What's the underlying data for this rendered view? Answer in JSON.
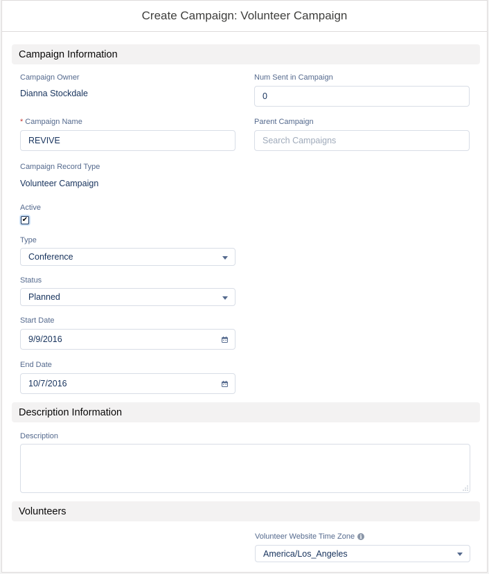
{
  "modal": {
    "title": "Create Campaign: Volunteer Campaign"
  },
  "sections": {
    "campaign_info": "Campaign Information",
    "description_info": "Description Information",
    "volunteers": "Volunteers"
  },
  "fields": {
    "campaign_owner": {
      "label": "Campaign Owner",
      "value": "Dianna Stockdale"
    },
    "num_sent": {
      "label": "Num Sent in Campaign",
      "value": "0"
    },
    "campaign_name": {
      "required_mark": "*",
      "label": "Campaign Name",
      "value": "REVIVE"
    },
    "parent_campaign": {
      "label": "Parent Campaign",
      "placeholder": "Search Campaigns"
    },
    "record_type": {
      "label": "Campaign Record Type",
      "value": "Volunteer Campaign"
    },
    "active": {
      "label": "Active",
      "checked": true,
      "check_glyph": "✔"
    },
    "type": {
      "label": "Type",
      "value": "Conference"
    },
    "status": {
      "label": "Status",
      "value": "Planned"
    },
    "start_date": {
      "label": "Start Date",
      "value": "9/9/2016"
    },
    "end_date": {
      "label": "End Date",
      "value": "10/7/2016"
    },
    "description": {
      "label": "Description",
      "value": ""
    },
    "time_zone": {
      "label": "Volunteer Website Time Zone",
      "info_glyph": "i",
      "value": "America/Los_Angeles"
    }
  },
  "icons": {
    "select": "chevron-down-icon",
    "date": "calendar-icon",
    "resize": "resize-handle-icon",
    "help": "info-icon"
  },
  "colors": {
    "label": "#54698d",
    "value": "#16325c",
    "required": "#c23934",
    "section_bg": "#f3f2f2",
    "border": "#d8dde6"
  }
}
